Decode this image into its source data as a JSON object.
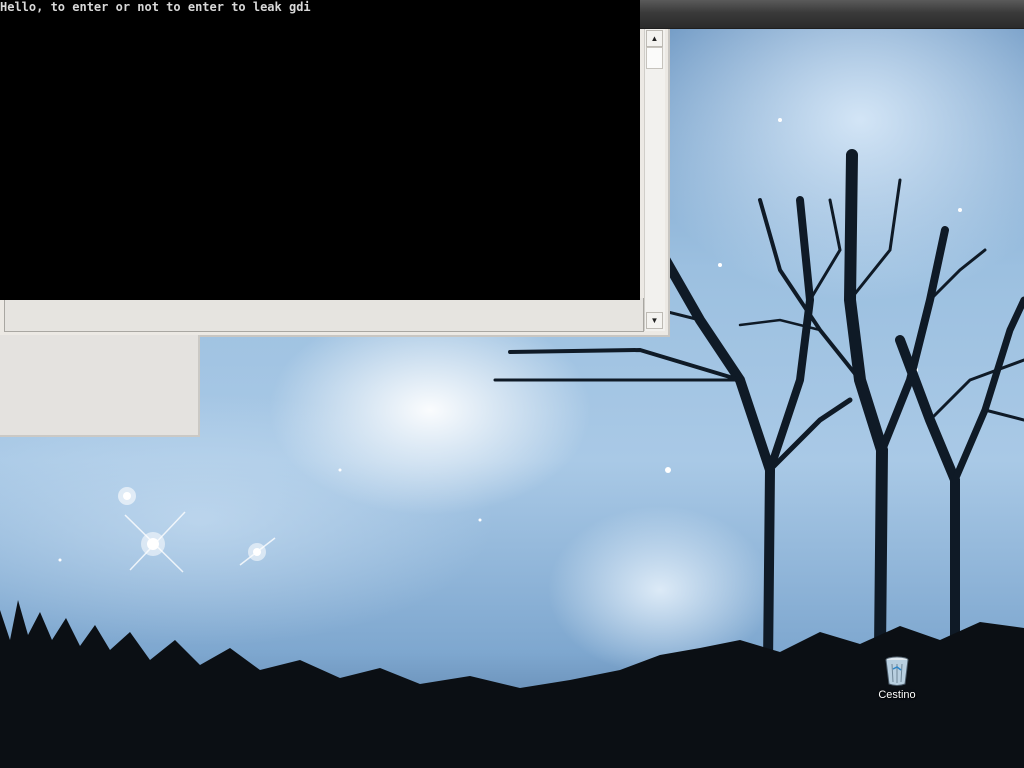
{
  "console": {
    "output_text": "Hello, to enter or not to enter to leak gdi"
  },
  "background_window": {
    "scrollbar": {
      "up_arrow": "▲",
      "down_arrow": "▼"
    }
  },
  "desktop": {
    "icons": [
      {
        "label": "Cestino",
        "icon": "recycle-bin-icon"
      }
    ]
  },
  "colors": {
    "console_bg": "#000000",
    "console_text": "#d8d8d8",
    "window_gray": "#ece9e4",
    "titlebar_dark": "#2b2b2b"
  }
}
